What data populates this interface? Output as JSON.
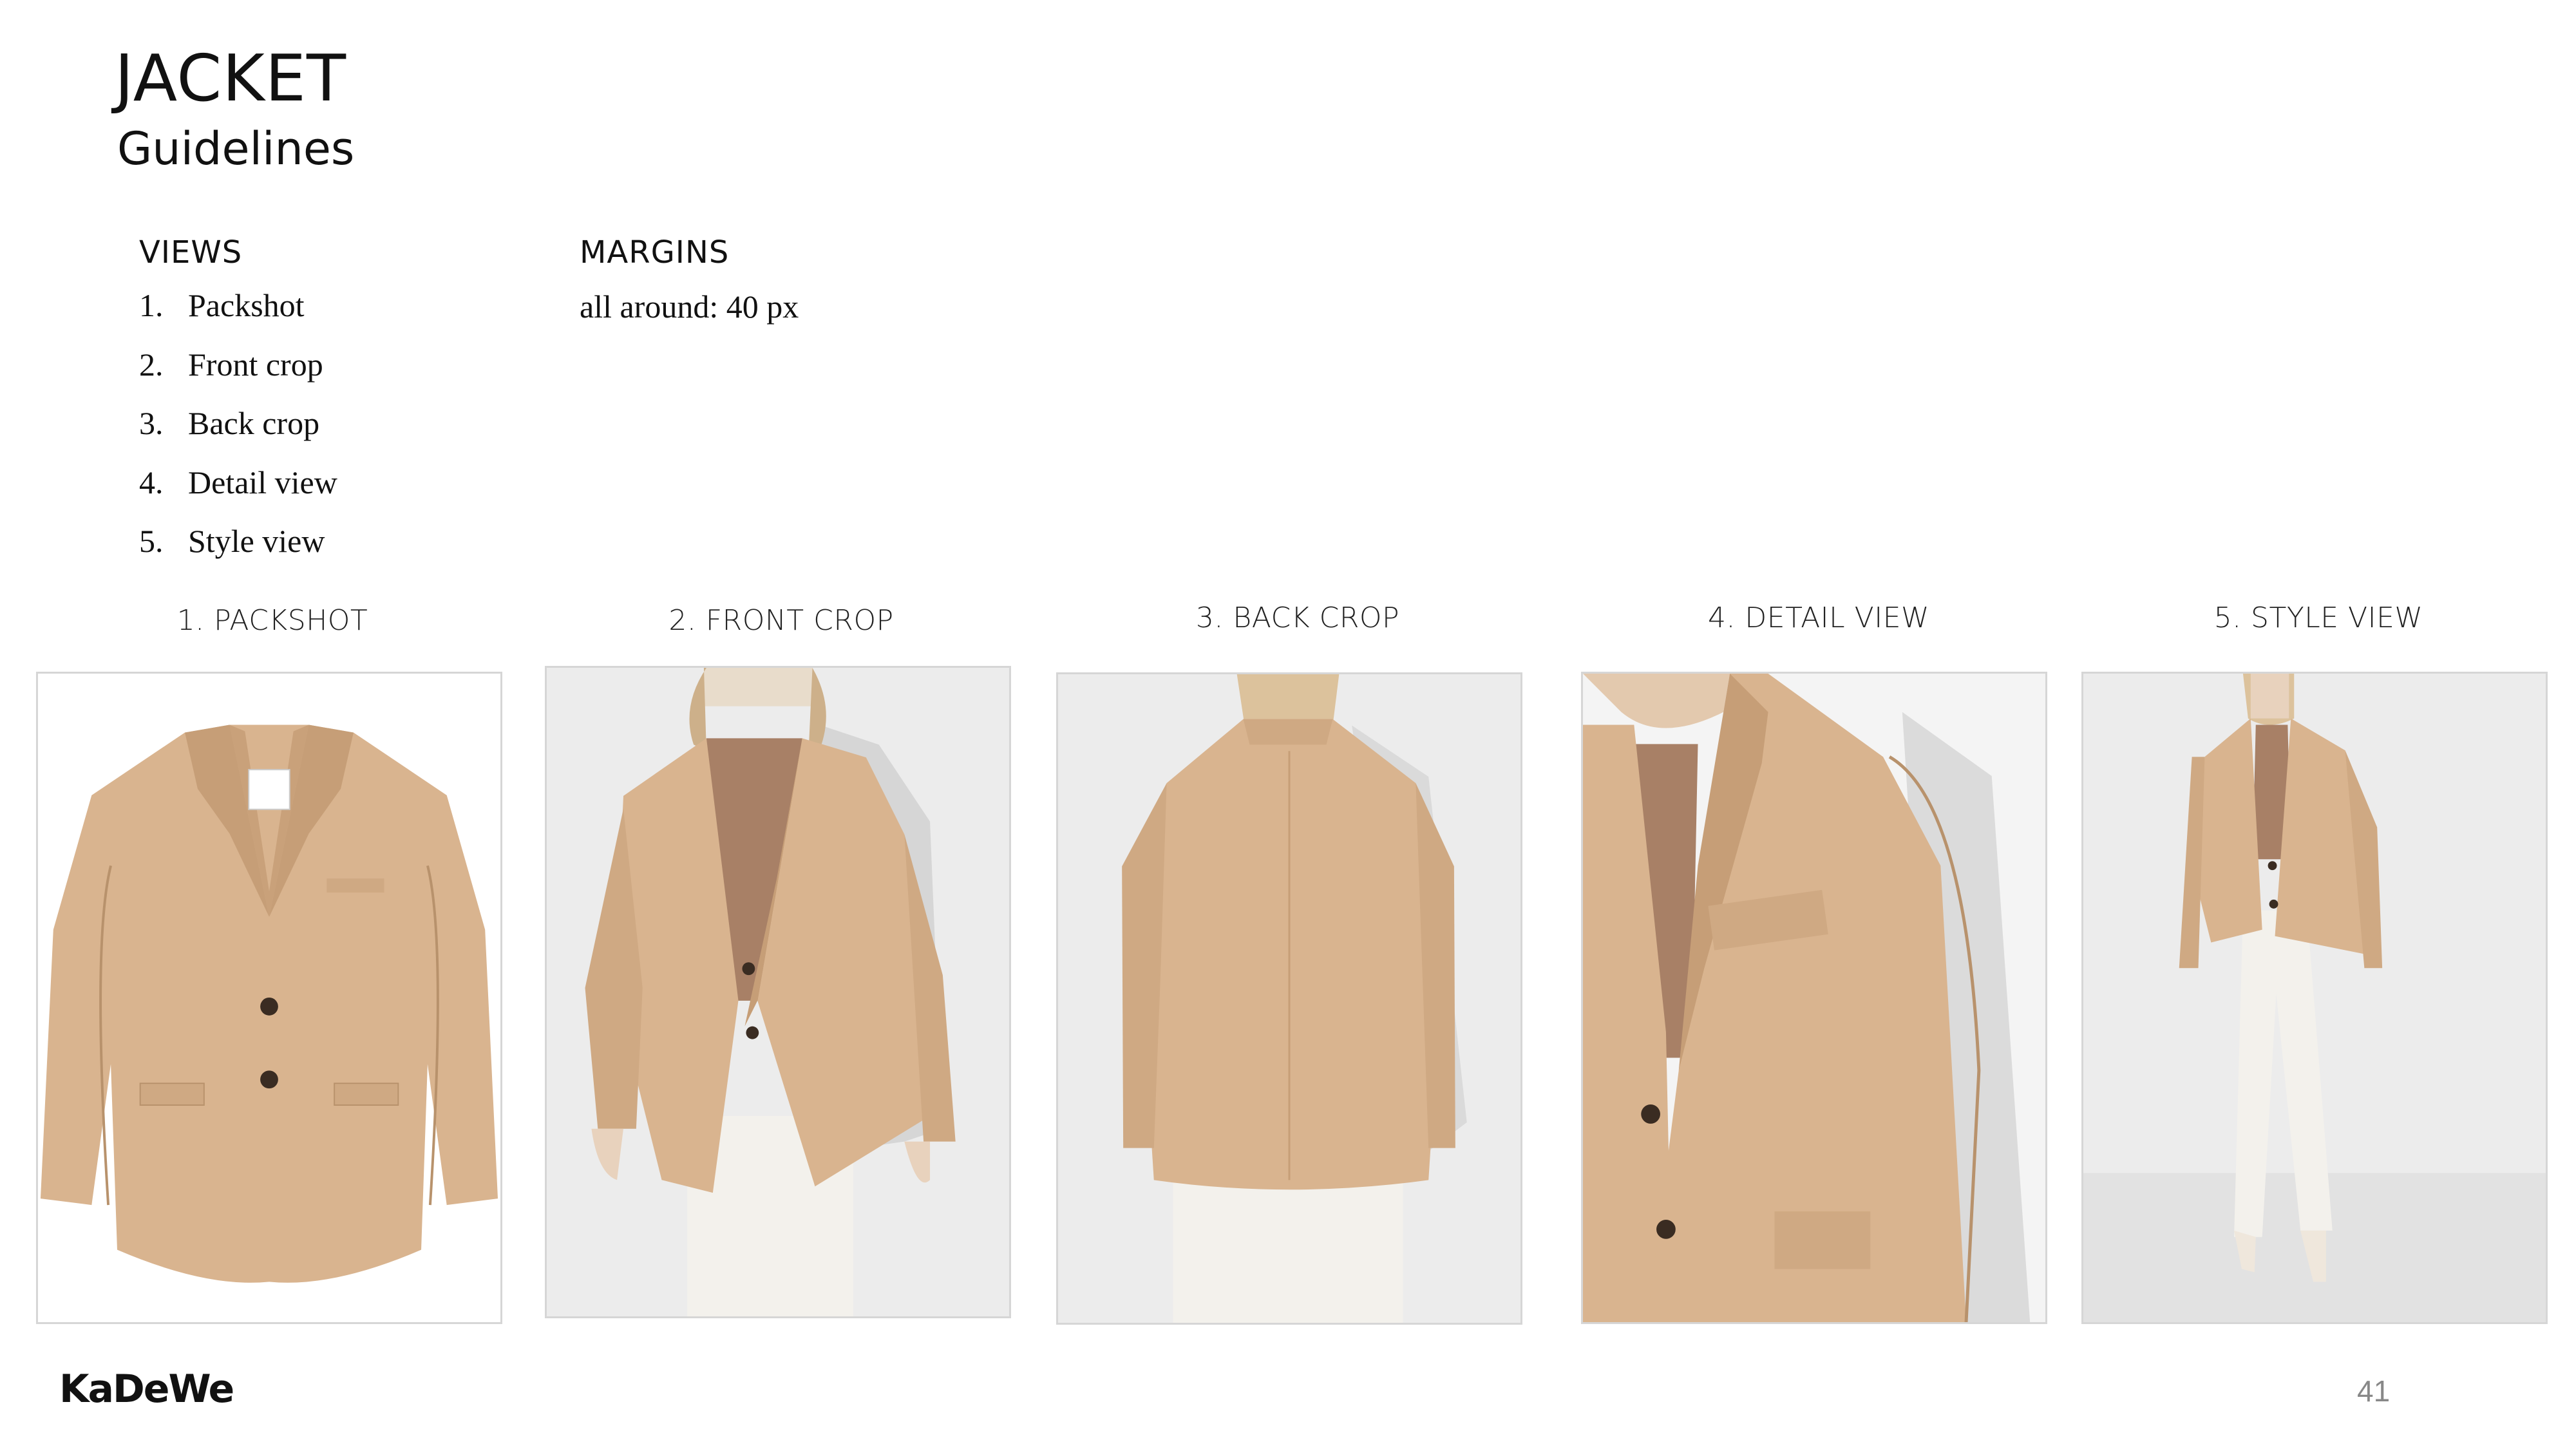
{
  "header": {
    "title": "JACKET",
    "subtitle": "Guidelines"
  },
  "views": {
    "heading": "VIEWS",
    "items": [
      {
        "num": "1.",
        "label": "Packshot"
      },
      {
        "num": "2.",
        "label": "Front crop"
      },
      {
        "num": "3.",
        "label": "Back crop"
      },
      {
        "num": "4.",
        "label": "Detail view"
      },
      {
        "num": "5.",
        "label": "Style view"
      }
    ]
  },
  "margins": {
    "heading": "MARGINS",
    "value": "all around: 40 px"
  },
  "panels": [
    {
      "caption": "1. PACKSHOT"
    },
    {
      "caption": "2. FRONT CROP"
    },
    {
      "caption": "3. BACK CROP"
    },
    {
      "caption": "4. DETAIL VIEW"
    },
    {
      "caption": "5. STYLE VIEW"
    }
  ],
  "footer": {
    "logo": "KaDeWe",
    "page_number": "41"
  },
  "colors": {
    "camel": "#d9b48f",
    "camel_shadow": "#b8926c",
    "knit": "#a88066",
    "backdrop": "#ececec",
    "trouser": "#f3f1ec"
  }
}
